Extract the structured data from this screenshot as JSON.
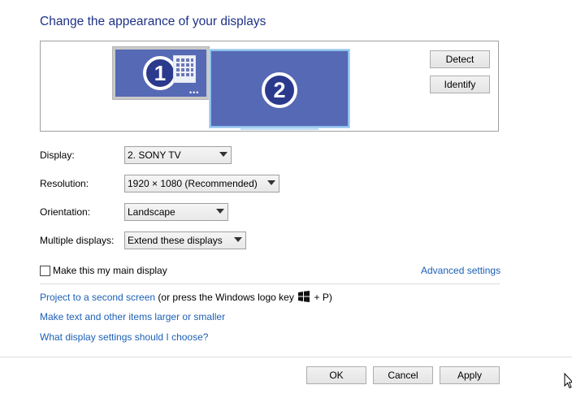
{
  "header": {
    "title": "Change the appearance of your displays"
  },
  "monitors": [
    {
      "number": "1",
      "dots": "•••"
    },
    {
      "number": "2"
    }
  ],
  "panel_buttons": {
    "detect": "Detect",
    "identify": "Identify"
  },
  "settings": {
    "display": {
      "label": "Display:",
      "value": "2. SONY TV"
    },
    "resolution": {
      "label": "Resolution:",
      "value": "1920 × 1080 (Recommended)"
    },
    "orientation": {
      "label": "Orientation:",
      "value": "Landscape"
    },
    "multiple": {
      "label": "Multiple displays:",
      "value": "Extend these displays"
    }
  },
  "main_display": {
    "label": "Make this my main display",
    "checked": false
  },
  "advanced_link": "Advanced settings",
  "links": {
    "project": "Project to a second screen",
    "project_hint_prefix": " (or press the Windows logo key ",
    "project_hint_suffix": " + P)",
    "text_size": "Make text and other items larger or smaller",
    "help": "What display settings should I choose?"
  },
  "footer": {
    "ok": "OK",
    "cancel": "Cancel",
    "apply": "Apply"
  },
  "colors": {
    "title": "#1e3287",
    "link": "#1c5fb6",
    "monitor": "#5669b5",
    "selected_border": "#8fc0ea"
  },
  "icons": {
    "windows": "windows-logo-icon",
    "cursor": "mouse-pointer-icon"
  }
}
